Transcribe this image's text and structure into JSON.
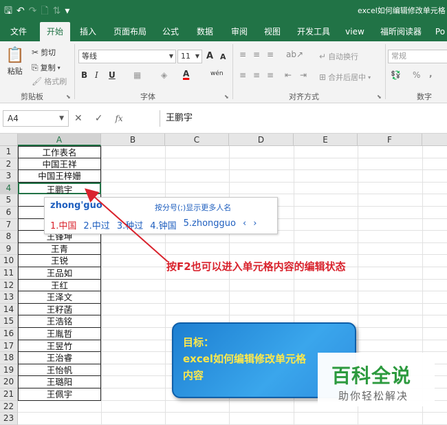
{
  "window": {
    "title": "excel如何编辑修改单元格",
    "qat": {
      "save_icon": "save-icon",
      "undo_icon": "undo-icon",
      "redo_icon": "redo-icon",
      "preview_icon": "print-preview-icon",
      "sort_icon": "sort-icon",
      "customize_icon": "customize-qat-icon"
    }
  },
  "tabs": [
    "文件",
    "开始",
    "插入",
    "页面布局",
    "公式",
    "数据",
    "审阅",
    "视图",
    "开发工具",
    "view",
    "福昕阅读器",
    "Po"
  ],
  "active_tab": "开始",
  "ribbon": {
    "clipboard": {
      "paste": "粘贴",
      "cut": "剪切",
      "copy": "复制",
      "format_painter": "格式刷",
      "label": "剪贴板"
    },
    "font": {
      "font_name": "等线",
      "font_size": "11",
      "bold": "B",
      "italic": "I",
      "underline": "U",
      "grow": "A",
      "shrink": "A",
      "font_color": "A",
      "phonetic": "wén",
      "label": "字体"
    },
    "alignment": {
      "wrap": "自动换行",
      "merge": "合并后居中",
      "label": "对齐方式"
    },
    "number": {
      "format": "常规",
      "percent": "%",
      "comma": ",",
      "label": "数字"
    }
  },
  "formula_bar": {
    "name_box": "A4",
    "cancel": "✕",
    "enter": "✓",
    "fx": "fx",
    "content": "王鹏宇"
  },
  "grid": {
    "columns": [
      "A",
      "B",
      "C",
      "D",
      "E",
      "F"
    ],
    "rows": [
      "1",
      "2",
      "3",
      "4",
      "5",
      "6",
      "7",
      "8",
      "9",
      "10",
      "11",
      "12",
      "13",
      "14",
      "15",
      "16",
      "17",
      "18",
      "19",
      "20",
      "21",
      "22",
      "23"
    ],
    "active_cell": "A4",
    "column_a": [
      "工作表名",
      "中国王祥",
      "中国王梓姗",
      "王鹏宇",
      "",
      "",
      "",
      "王锋坤",
      "王青",
      "王锐",
      "王品如",
      "王红",
      "王泽文",
      "王籽菡",
      "王浩铭",
      "王胤哲",
      "王昱竹",
      "王治睿",
      "王怡帆",
      "王璐阳",
      "王佩宇",
      "",
      ""
    ]
  },
  "ime": {
    "pinyin": "zhong'guo",
    "hint": "按分号(;)显示更多人名",
    "candidates": [
      "1.中国",
      "2.中过",
      "3.种过",
      "4.钟国",
      "5.zhongguo"
    ],
    "prev": "‹",
    "next": "›"
  },
  "annotation": "按F2也可以进入单元格内容的编辑状态",
  "goal_box": {
    "line1": "目标：",
    "line2": "excel如何编辑修改单元格",
    "line3": "内容"
  },
  "watermark": {
    "title": "百科全说",
    "subtitle": "助你轻松解决"
  },
  "colors": {
    "excel_green": "#217346",
    "annotation_red": "#d9232d",
    "ime_blue": "#1f5fbf",
    "goal_blue": "#2f8fe0",
    "goal_text": "#ffe84a",
    "watermark_green": "#2c9a3e"
  }
}
